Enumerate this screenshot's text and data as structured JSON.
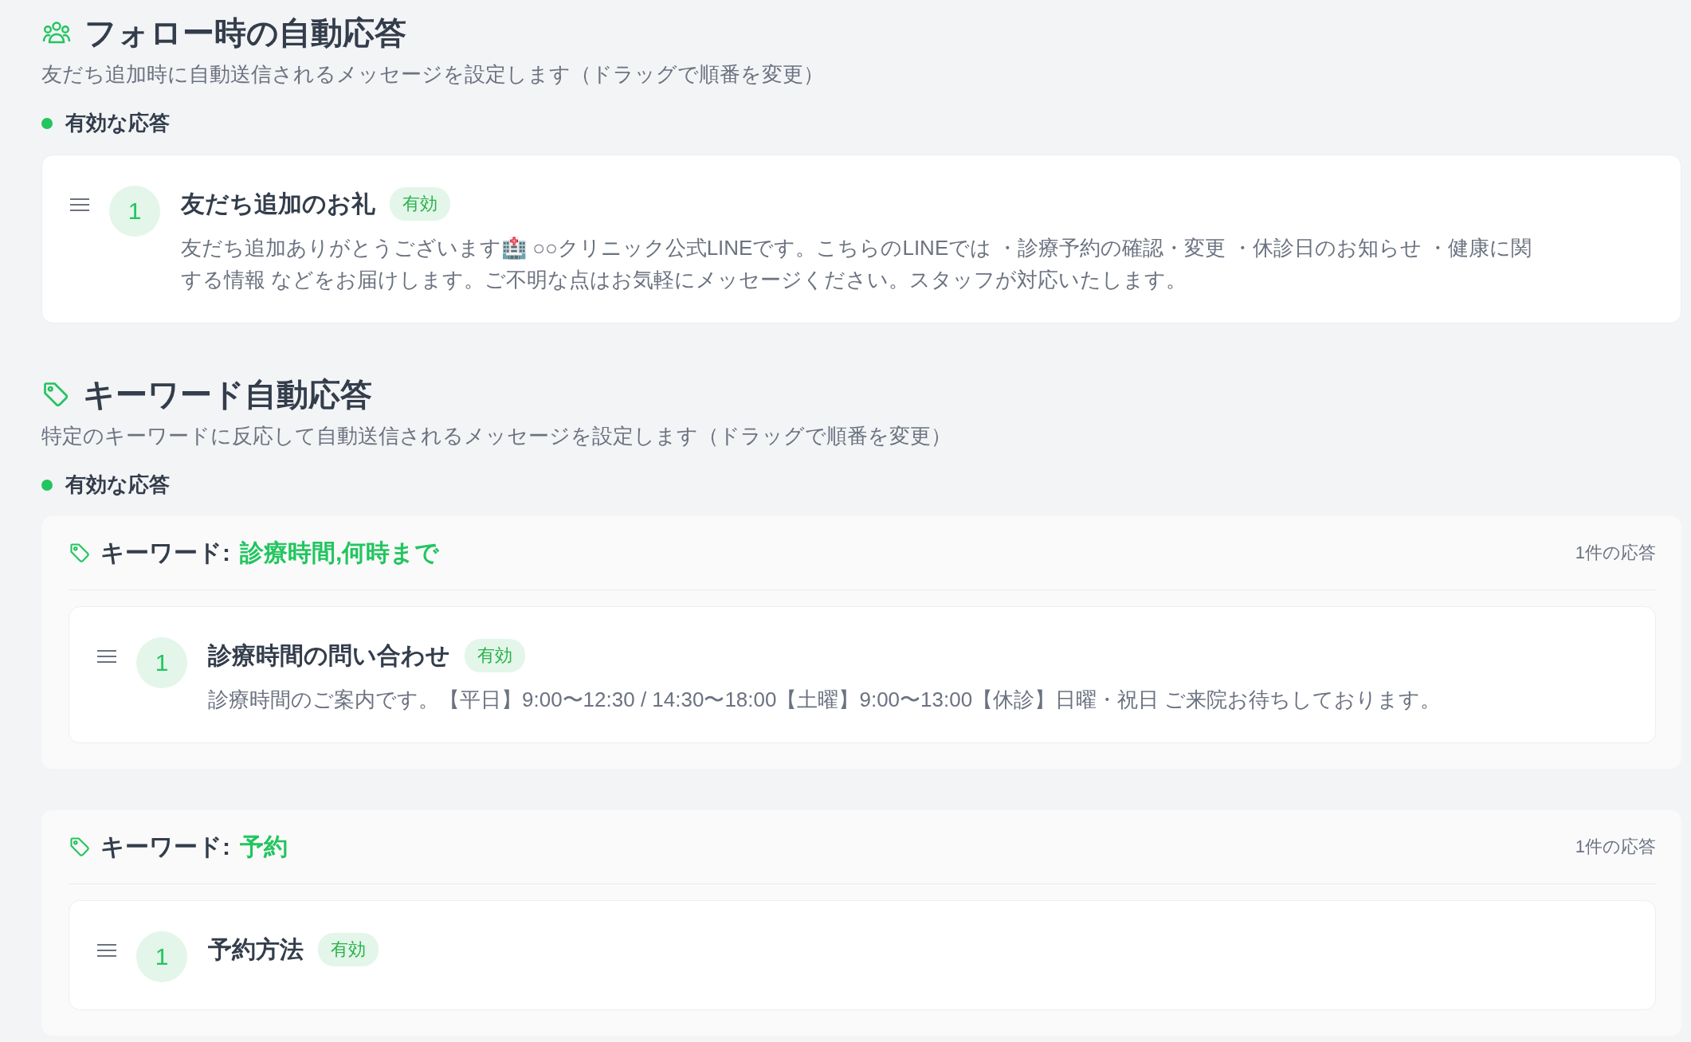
{
  "sections": [
    {
      "kind": "follow",
      "title": "フォロー時の自動応答",
      "description": "友だち追加時に自動送信されるメッセージを設定します（ドラッグで順番を変更）",
      "status_label": "有効な応答",
      "responses": [
        {
          "order": "1",
          "title": "友だち追加のお礼",
          "badge": "有効",
          "message": "友だち追加ありがとうございます🏥 ○○クリニック公式LINEです。こちらのLINEでは ・診療予約の確認・変更 ・休診日のお知らせ ・健康に関する情報 などをお届けします。ご不明な点はお気軽にメッセージください。スタッフが対応いたします。"
        }
      ]
    },
    {
      "kind": "keyword",
      "title": "キーワード自動応答",
      "description": "特定のキーワードに反応して自動送信されるメッセージを設定します（ドラッグで順番を変更）",
      "status_label": "有効な応答",
      "keyword_groups": [
        {
          "label": "キーワード:",
          "keywords": "診療時間,何時まで",
          "count": "1件の応答",
          "responses": [
            {
              "order": "1",
              "title": "診療時間の問い合わせ",
              "badge": "有効",
              "message": "診療時間のご案内です。【平日】9:00〜12:30 / 14:30〜18:00【土曜】9:00〜13:00【休診】日曜・祝日 ご来院お待ちしております。"
            }
          ]
        },
        {
          "label": "キーワード:",
          "keywords": "予約",
          "count": "1件の応答",
          "responses": [
            {
              "order": "1",
              "title": "予約方法",
              "badge": "有効"
            }
          ]
        }
      ]
    }
  ]
}
